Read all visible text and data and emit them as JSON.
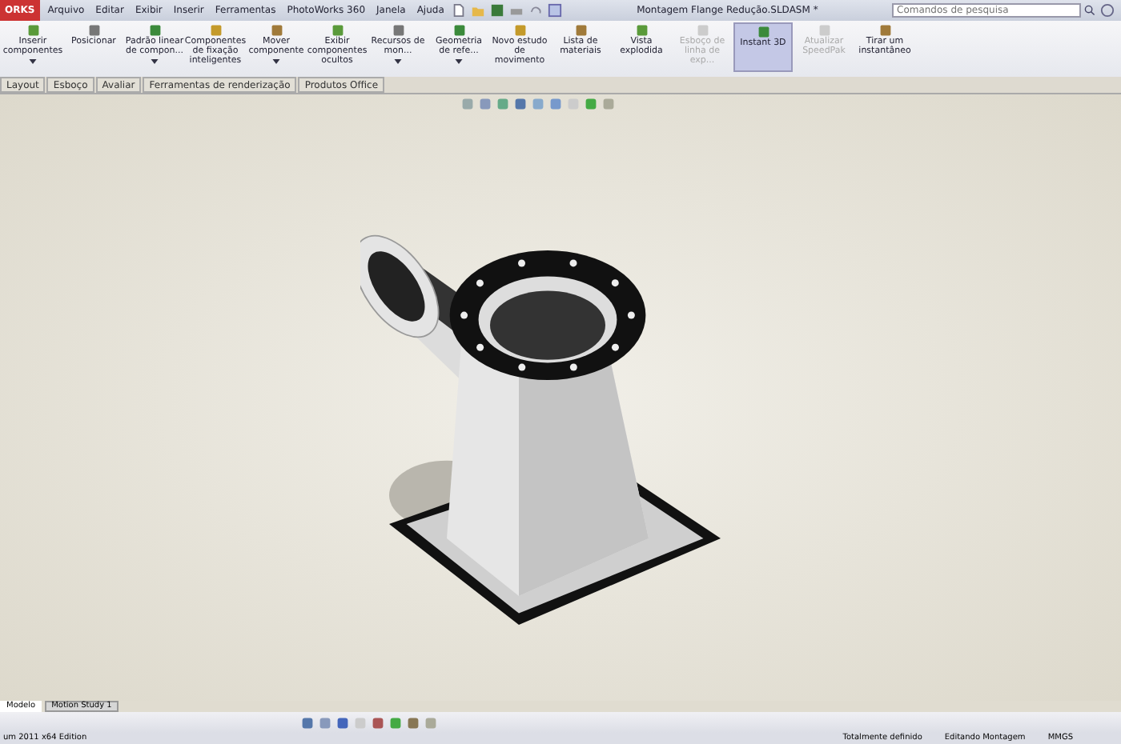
{
  "window": {
    "logo": "ORKS",
    "title": "Montagem Flange Redução.SLDASM *"
  },
  "menu": [
    "Arquivo",
    "Editar",
    "Exibir",
    "Inserir",
    "Ferramentas",
    "PhotoWorks 360",
    "Janela",
    "Ajuda"
  ],
  "search": {
    "placeholder": "Comandos de pesquisa"
  },
  "commands": [
    {
      "label": "Inserir componentes",
      "disabled": false,
      "selected": false,
      "dropdown": true
    },
    {
      "label": "Posicionar",
      "disabled": false,
      "selected": false,
      "dropdown": false
    },
    {
      "label": "Padrão linear de compon...",
      "disabled": false,
      "selected": false,
      "dropdown": true
    },
    {
      "label": "Componentes de fixação inteligentes",
      "disabled": false,
      "selected": false,
      "dropdown": false
    },
    {
      "label": "Mover componente",
      "disabled": false,
      "selected": false,
      "dropdown": true
    },
    {
      "label": "Exibir componentes ocultos",
      "disabled": false,
      "selected": false,
      "dropdown": false
    },
    {
      "label": "Recursos de mon...",
      "disabled": false,
      "selected": false,
      "dropdown": true
    },
    {
      "label": "Geometria de refe...",
      "disabled": false,
      "selected": false,
      "dropdown": true
    },
    {
      "label": "Novo estudo de movimento",
      "disabled": false,
      "selected": false,
      "dropdown": false
    },
    {
      "label": "Lista de materiais",
      "disabled": false,
      "selected": false,
      "dropdown": false
    },
    {
      "label": "Vista explodida",
      "disabled": false,
      "selected": false,
      "dropdown": false
    },
    {
      "label": "Esboço de linha de exp...",
      "disabled": true,
      "selected": false,
      "dropdown": false
    },
    {
      "label": "Instant 3D",
      "disabled": false,
      "selected": true,
      "dropdown": false
    },
    {
      "label": "Atualizar SpeedPak",
      "disabled": true,
      "selected": false,
      "dropdown": false
    },
    {
      "label": "Tirar um instantâneo",
      "disabled": false,
      "selected": false,
      "dropdown": false
    }
  ],
  "tabs": [
    {
      "label": "Layout",
      "selected": false
    },
    {
      "label": "Esboço",
      "selected": false
    },
    {
      "label": "Avaliar",
      "selected": false
    },
    {
      "label": "Ferramentas de renderização",
      "selected": false
    },
    {
      "label": "Produtos Office",
      "selected": false
    }
  ],
  "bottom_tabs": [
    {
      "label": "Modelo",
      "selected": true
    },
    {
      "label": "Motion Study 1",
      "selected": false
    }
  ],
  "status_bar": {
    "product": "um 2011 x64 Edition",
    "state": "Totalmente definido",
    "mode": "Editando Montagem",
    "units": "MMGS"
  }
}
